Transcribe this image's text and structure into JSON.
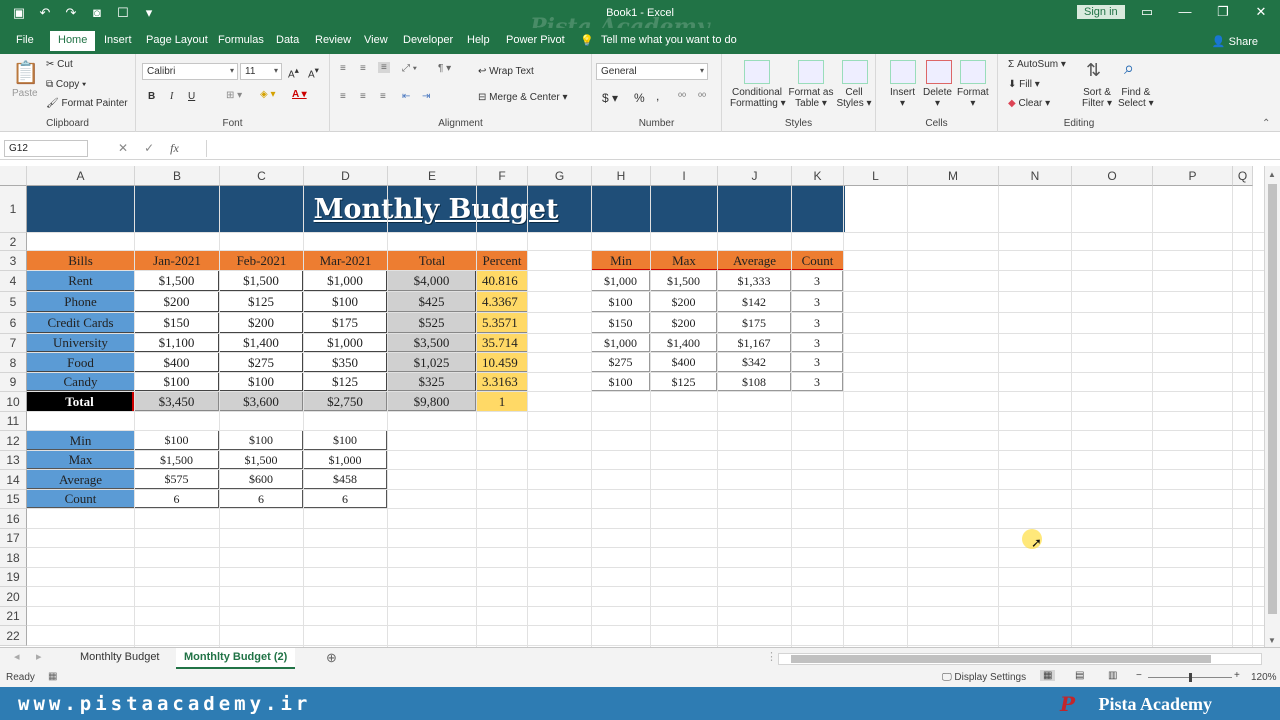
{
  "window": {
    "title": "Book1  -  Excel",
    "watermark": "Pista Academy",
    "signin": "Sign in"
  },
  "ribbon_tabs": [
    "File",
    "Home",
    "Insert",
    "Page Layout",
    "Formulas",
    "Data",
    "Review",
    "View",
    "Developer",
    "Help",
    "Power Pivot"
  ],
  "tell_me": "Tell me what you want to do",
  "share": "Share",
  "clipboard": {
    "paste": "Paste",
    "cut": "Cut",
    "copy": "Copy",
    "format_painter": "Format Painter",
    "label": "Clipboard"
  },
  "font": {
    "name": "Calibri",
    "size": "11",
    "label": "Font",
    "bold": "B",
    "italic": "I",
    "underline": "U"
  },
  "alignment": {
    "wrap_text": "Wrap Text",
    "merge_center": "Merge & Center",
    "label": "Alignment"
  },
  "number": {
    "format": "General",
    "currency": "$",
    "percent": "%",
    "comma": ",",
    "label": "Number"
  },
  "styles": {
    "conditional": "Conditional",
    "conditional2": "Formatting",
    "format_table": "Format as",
    "format_table2": "Table",
    "cell_styles": "Cell",
    "cell_styles2": "Styles",
    "label": "Styles"
  },
  "cells": {
    "insert": "Insert",
    "delete": "Delete",
    "format": "Format",
    "label": "Cells"
  },
  "editing": {
    "autosum": "AutoSum",
    "fill": "Fill",
    "clear": "Clear",
    "sort": "Sort &",
    "sort2": "Filter",
    "find": "Find &",
    "find2": "Select",
    "label": "Editing"
  },
  "formula_bar": {
    "name_box": "G12",
    "formula": "",
    "fx": "fx"
  },
  "columns": [
    "A",
    "B",
    "C",
    "D",
    "E",
    "F",
    "G",
    "H",
    "I",
    "J",
    "K",
    "L",
    "M",
    "N",
    "O",
    "P",
    "Q"
  ],
  "rows": [
    "1",
    "2",
    "3",
    "4",
    "5",
    "6",
    "7",
    "8",
    "9",
    "10",
    "11",
    "12",
    "13",
    "14",
    "15",
    "16",
    "17",
    "18",
    "19",
    "20",
    "21",
    "22"
  ],
  "sheet_title": "Monthly Budget",
  "budget_table": {
    "headers": [
      "Bills",
      "Jan-2021",
      "Feb-2021",
      "Mar-2021",
      "Total",
      "Percent"
    ],
    "rows": [
      [
        "Rent",
        "$1,500",
        "$1,500",
        "$1,000",
        "$4,000",
        "40.816"
      ],
      [
        "Phone",
        "$200",
        "$125",
        "$100",
        "$425",
        "4.3367"
      ],
      [
        "Credit Cards",
        "$150",
        "$200",
        "$175",
        "$525",
        "5.3571"
      ],
      [
        "University",
        "$1,100",
        "$1,400",
        "$1,000",
        "$3,500",
        "35.714"
      ],
      [
        "Food",
        "$400",
        "$275",
        "$350",
        "$1,025",
        "10.459"
      ],
      [
        "Candy",
        "$100",
        "$100",
        "$125",
        "$325",
        "3.3163"
      ]
    ],
    "total_row": [
      "Total",
      "$3,450",
      "$3,600",
      "$2,750",
      "$9,800",
      "1"
    ]
  },
  "stats_table": {
    "headers": [
      "Min",
      "Max",
      "Average",
      "Count"
    ],
    "rows": [
      [
        "$1,000",
        "$1,500",
        "$1,333",
        "3"
      ],
      [
        "$100",
        "$200",
        "$142",
        "3"
      ],
      [
        "$150",
        "$200",
        "$175",
        "3"
      ],
      [
        "$1,000",
        "$1,400",
        "$1,167",
        "3"
      ],
      [
        "$275",
        "$400",
        "$342",
        "3"
      ],
      [
        "$100",
        "$125",
        "$108",
        "3"
      ]
    ]
  },
  "summary_table": {
    "rows": [
      [
        "Min",
        "$100",
        "$100",
        "$100"
      ],
      [
        "Max",
        "$1,500",
        "$1,500",
        "$1,000"
      ],
      [
        "Average",
        "$575",
        "$600",
        "$458"
      ],
      [
        "Count",
        "6",
        "6",
        "6"
      ]
    ]
  },
  "sheet_tabs": [
    "Monthlty Budget",
    "Monthlty Budget (2)"
  ],
  "active_sheet_index": 1,
  "status": {
    "ready": "Ready",
    "display_settings": "Display Settings",
    "zoom": "120%"
  },
  "footer": {
    "url": "www.pistaacademy.ir",
    "brand": "Pista Academy",
    "brand_mark": "P"
  },
  "colors": {
    "excel_green": "#217346",
    "title_band": "#1f4e78",
    "header_orange": "#ed7d31",
    "label_blue": "#5b9bd5",
    "total_gray": "#d0d0d0",
    "percent_yellow": "#ffd966",
    "footer_blue": "#2e7cb3"
  }
}
